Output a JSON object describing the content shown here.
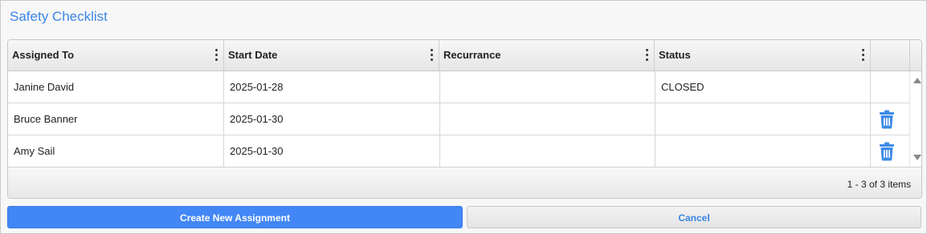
{
  "title": "Safety Checklist",
  "columns": [
    "Assigned To",
    "Start Date",
    "Recurrance",
    "Status",
    ""
  ],
  "rows": [
    {
      "assigned_to": "Janine David",
      "start_date": "2025-01-28",
      "recurrance": "",
      "status": "CLOSED",
      "deletable": false
    },
    {
      "assigned_to": "Bruce Banner",
      "start_date": "2025-01-30",
      "recurrance": "",
      "status": "",
      "deletable": true
    },
    {
      "assigned_to": "Amy Sail",
      "start_date": "2025-01-30",
      "recurrance": "",
      "status": "",
      "deletable": true
    }
  ],
  "pager": {
    "info": "1 - 3 of 3 items"
  },
  "buttons": {
    "create": "Create New Assignment",
    "cancel": "Cancel"
  },
  "icons": {
    "column_menu": "kebab-menu-icon",
    "delete": "trash-icon",
    "scroll_up": "arrow-up-icon",
    "scroll_down": "arrow-down-icon"
  },
  "colors": {
    "accent": "#4287f5",
    "title": "#3b86e6"
  }
}
